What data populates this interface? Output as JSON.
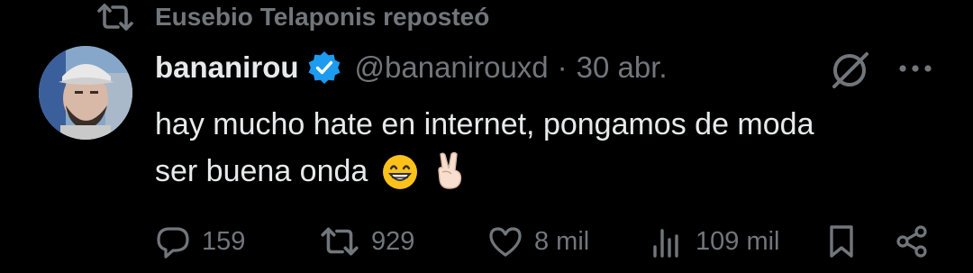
{
  "repost_banner": {
    "text": "Eusebio Telaponis reposteó",
    "icon": "repost-icon"
  },
  "tweet": {
    "display_name": "bananirou",
    "handle": "@bananirouxd",
    "separator": "·",
    "date": "30 abr.",
    "verified": true,
    "text_line1": "hay mucho hate en internet, pongamos de moda",
    "text_line2": "ser buena onda",
    "emojis": [
      "grinning-face-emoji",
      "victory-hand-emoji"
    ]
  },
  "actions": {
    "replies": "159",
    "reposts": "929",
    "likes": "8 mil",
    "views": "109 mil"
  },
  "colors": {
    "background": "#000000",
    "text_primary": "#e7e9ea",
    "text_secondary": "#71767b",
    "verified_blue": "#1d9bf0"
  }
}
